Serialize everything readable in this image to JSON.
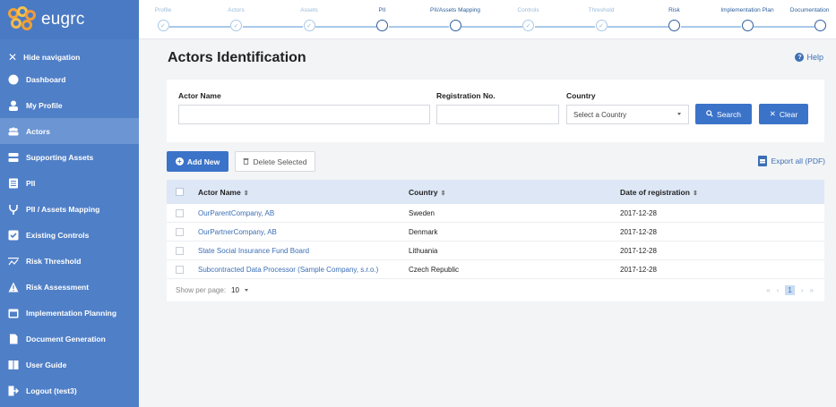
{
  "brand": {
    "name": "eugrc"
  },
  "sidebar": {
    "hide_label": "Hide navigation",
    "items": [
      {
        "label": "Dashboard",
        "icon": "dashboard-icon",
        "active": false
      },
      {
        "label": "My Profile",
        "icon": "user-icon",
        "active": false
      },
      {
        "label": "Actors",
        "icon": "people-icon",
        "active": true
      },
      {
        "label": "Supporting Assets",
        "icon": "server-icon",
        "active": false
      },
      {
        "label": "PII",
        "icon": "list-icon",
        "active": false
      },
      {
        "label": "PII / Assets Mapping",
        "icon": "mapping-icon",
        "active": false
      },
      {
        "label": "Existing Controls",
        "icon": "checkbox-icon",
        "active": false
      },
      {
        "label": "Risk Threshold",
        "icon": "threshold-icon",
        "active": false
      },
      {
        "label": "Risk Assessment",
        "icon": "warning-icon",
        "active": false
      },
      {
        "label": "Implementation Planning",
        "icon": "calendar-icon",
        "active": false
      },
      {
        "label": "Document Generation",
        "icon": "document-icon",
        "active": false
      },
      {
        "label": "User Guide",
        "icon": "book-icon",
        "active": false
      },
      {
        "label": "Logout (test3)",
        "icon": "logout-icon",
        "active": false
      }
    ]
  },
  "stepper": {
    "steps": [
      {
        "label": "Profile",
        "done": true
      },
      {
        "label": "Actors",
        "done": true
      },
      {
        "label": "Assets",
        "done": true
      },
      {
        "label": "PII",
        "done": false
      },
      {
        "label": "PII/Assets Mapping",
        "done": false
      },
      {
        "label": "Controls",
        "done": true
      },
      {
        "label": "Threshold",
        "done": true
      },
      {
        "label": "Risk",
        "done": false
      },
      {
        "label": "Implementation Plan",
        "done": false
      },
      {
        "label": "Documentation",
        "done": false
      }
    ]
  },
  "page": {
    "title": "Actors Identification",
    "help": "Help"
  },
  "filters": {
    "actor_name_label": "Actor Name",
    "actor_name_value": "",
    "registration_label": "Registration No.",
    "registration_value": "",
    "country_label": "Country",
    "country_value": "Select a Country",
    "search_label": "Search",
    "clear_label": "Clear"
  },
  "toolbar": {
    "add_label": "Add New",
    "delete_label": "Delete Selected",
    "export_label": "Export all (PDF)"
  },
  "table": {
    "columns": [
      "Actor Name",
      "Country",
      "Date of registration"
    ],
    "rows": [
      {
        "name": "OurParentCompany, AB",
        "country": "Sweden",
        "date": "2017-12-28"
      },
      {
        "name": "OurPartnerCompany, AB",
        "country": "Denmark",
        "date": "2017-12-28"
      },
      {
        "name": "State Social Insurance Fund Board",
        "country": "Lithuania",
        "date": "2017-12-28"
      },
      {
        "name": "Subcontracted Data Processor (Sample Company, s.r.o.)",
        "country": "Czech Republic",
        "date": "2017-12-28"
      }
    ],
    "per_page_label": "Show per page:",
    "per_page_value": "10",
    "current_page": "1"
  },
  "colors": {
    "sidebar": "#4f7fc7",
    "accent": "#3b73c8",
    "header_row": "#dde7f6"
  }
}
